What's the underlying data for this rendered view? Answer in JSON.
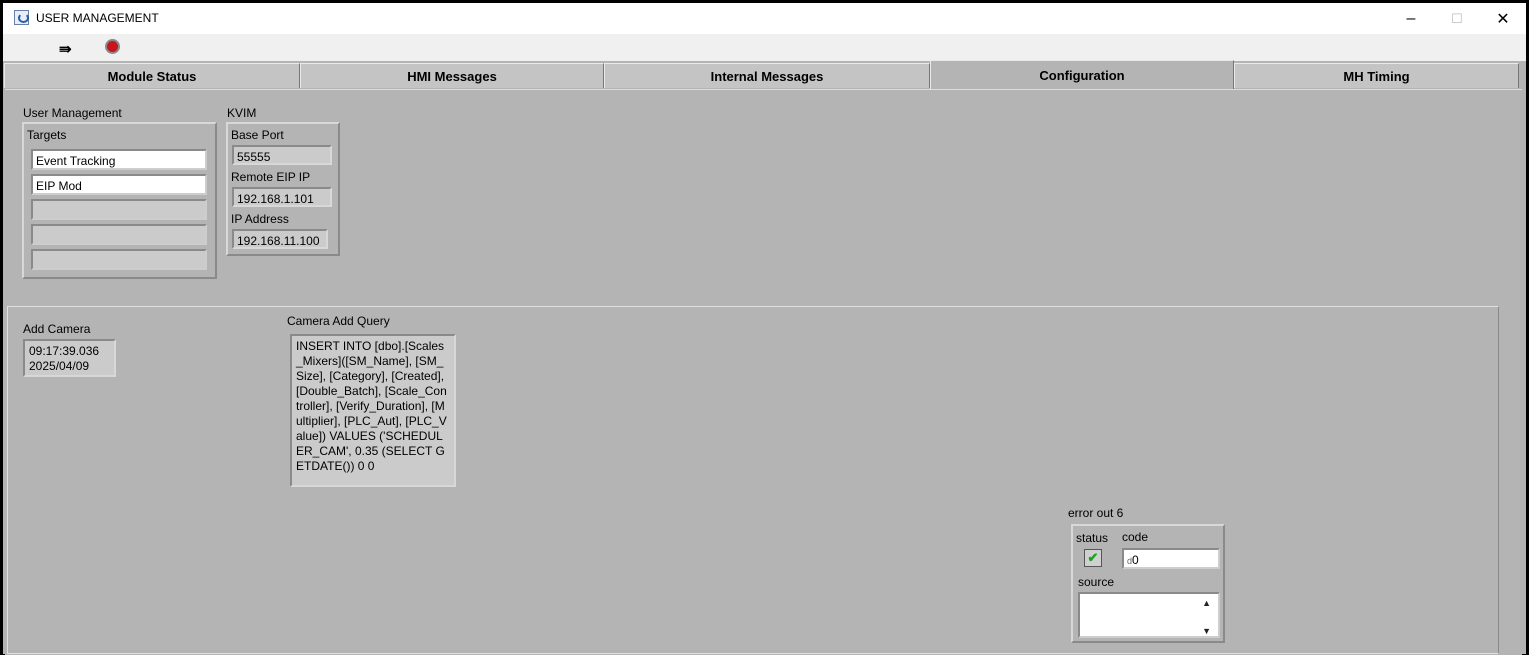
{
  "window": {
    "title": "USER MANAGEMENT",
    "controls": {
      "minimize": "–",
      "maximize": "☐",
      "close": "✕"
    }
  },
  "toolbar": {
    "run_icon": "run-arrow-icon",
    "stop_icon": "abort-stop-icon",
    "stop_color": "#c8151b"
  },
  "tabs": [
    {
      "label": "Module Status",
      "active": false
    },
    {
      "label": "HMI Messages",
      "active": false
    },
    {
      "label": "Internal Messages",
      "active": false
    },
    {
      "label": "Configuration",
      "active": true
    },
    {
      "label": "MH Timing",
      "active": false
    }
  ],
  "user_management": {
    "label": "User Management",
    "targets_label": "Targets",
    "targets": [
      "Event Tracking",
      "EIP Mod",
      "",
      "",
      ""
    ]
  },
  "kvim": {
    "label": "KVIM",
    "base_port_label": "Base Port",
    "base_port": "55555",
    "remote_eip_label": "Remote EIP IP",
    "remote_eip": "192.168.1.101",
    "ip_address_label": "IP Address",
    "ip_address": "192.168.11.100"
  },
  "add_camera": {
    "label": "Add Camera",
    "time": "09:17:39.036",
    "date": "2025/04/09"
  },
  "camera_add_query": {
    "label": "Camera Add Query",
    "text": "INSERT INTO [dbo].[Scales_Mixers]([SM_Name], [SM_Size], [Category], [Created], [Double_Batch], [Scale_Controller], [Verify_Duration], [Multiplier], [PLC_Aut], [PLC_Value]) VALUES ('SCHEDULER_CAM', 0.35 (SELECT GETDATE()) 0 0"
  },
  "error_out": {
    "label": "error out 6",
    "status_label": "status",
    "code_label": "code",
    "code_prefix": "d",
    "code": "0",
    "source_label": "source",
    "source": "",
    "status_icon": "check-icon",
    "status_color": "#1ea01e"
  }
}
